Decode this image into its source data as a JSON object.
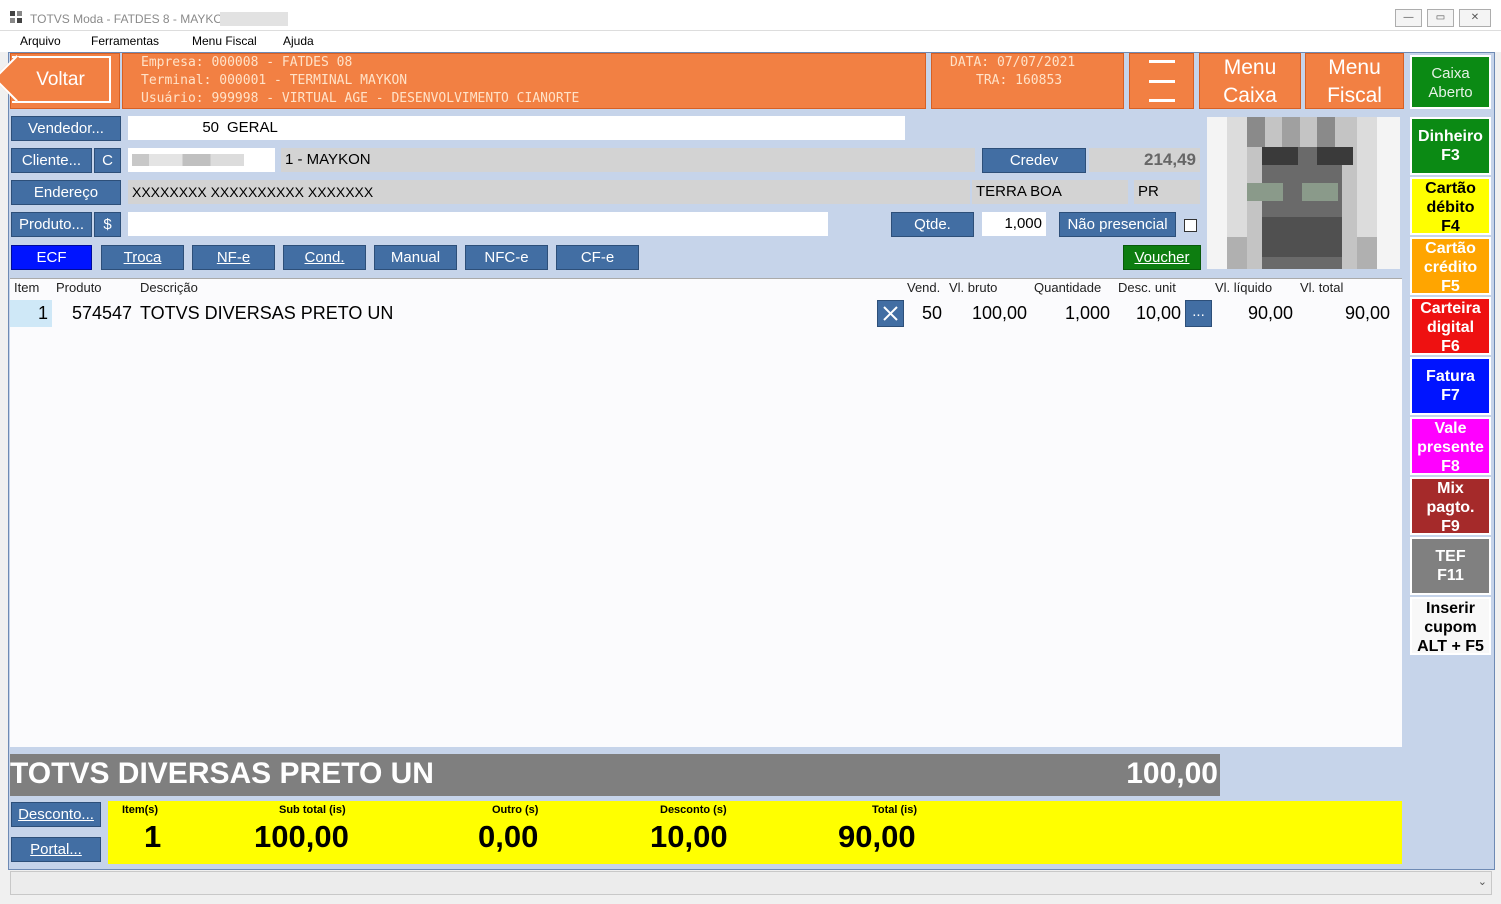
{
  "window": {
    "title": "TOTVS Moda - FATDES 8 - MAYKON",
    "minimize_glyph": "▭",
    "maximize_glyph": "▭",
    "close_glyph": "✕"
  },
  "menu": [
    "Arquivo",
    "Ferramentas",
    "Menu Fiscal",
    "Ajuda"
  ],
  "header": {
    "back_label": "Voltar",
    "empresa": "Empresa: 000008 - FATDES 08",
    "terminal": "Terminal: 000001 - TERMINAL MAYKON",
    "usuario": "Usuário: 999998 - VIRTUAL AGE - DESENVOLVIMENTO CIANORTE",
    "data": "DATA: 07/07/2021",
    "tra": "TRA: 160853",
    "menu_caixa_1": "Menu",
    "menu_caixa_2": "Caixa",
    "menu_fiscal_1": "Menu",
    "menu_fiscal_2": "Fiscal"
  },
  "form": {
    "vendedor_btn": "Vendedor...",
    "vendedor_code": "50",
    "vendedor_name": "GERAL",
    "cliente_btn": "Cliente...",
    "cliente_c": "C",
    "cliente_name": "1 - MAYKON",
    "credev_btn": "Credev",
    "credev_value": "214,49",
    "endereco_btn": "Endereço",
    "endereco_value": "XXXXXXXX XXXXXXXXXX XXXXXXX",
    "cidade": "TERRA BOA",
    "uf": "PR",
    "produto_btn": "Produto...",
    "produto_dollar": "$",
    "qtde_btn": "Qtde.",
    "qtde_value": "1,000",
    "nao_presencial": "Não presencial",
    "voucher_btn": "Voucher"
  },
  "doc_buttons": [
    "ECF",
    "Troca",
    "NF-e",
    "Cond.",
    "Manual",
    "NFC-e",
    "CF-e"
  ],
  "grid": {
    "headers": {
      "item": "Item",
      "produto": "Produto",
      "descricao": "Descrição",
      "vend": "Vend.",
      "vl_bruto": "Vl. bruto",
      "quantidade": "Quantidade",
      "desc_unit": "Desc. unit",
      "vl_liquido": "Vl. líquido",
      "vl_total": "Vl. total"
    },
    "row": {
      "item": "1",
      "produto": "574547",
      "descricao": "TOTVS DIVERSAS PRETO UN",
      "vend": "50",
      "vl_bruto": "100,00",
      "quantidade": "1,000",
      "desc_unit": "10,00",
      "more": "...",
      "vl_liquido": "90,00",
      "vl_total": "90,00"
    }
  },
  "current": {
    "description": "TOTVS DIVERSAS PRETO UN",
    "value": "100,00"
  },
  "bottom_buttons": {
    "desconto": "Desconto...",
    "portal": "Portal..."
  },
  "totals": {
    "itens_label": "Item(s)",
    "itens": "1",
    "subtotal_label": "Sub total (is)",
    "subtotal": "100,00",
    "outro_label": "Outro (s)",
    "outro": "0,00",
    "desconto_label": "Desconto (s)",
    "desconto": "10,00",
    "total_label": "Total (is)",
    "total": "90,00"
  },
  "side": {
    "caixa": "Caixa Aberto",
    "buttons": [
      {
        "label": "Dinheiro",
        "key": "F3",
        "bg": "#0b8a14",
        "color": "#ffffff"
      },
      {
        "label": "Cartão débito",
        "key": "F4",
        "bg": "#ffff00",
        "color": "#000000"
      },
      {
        "label": "Cartão crédito",
        "key": "F5",
        "bg": "#ffa500",
        "color": "#ffffff"
      },
      {
        "label": "Carteira digital",
        "key": "F6",
        "bg": "#ee1111",
        "color": "#ffffff"
      },
      {
        "label": "Fatura",
        "key": "F7",
        "bg": "#0014ff",
        "color": "#ffffff"
      },
      {
        "label": "Vale presente",
        "key": "F8",
        "bg": "#ff00ff",
        "color": "#ffffff"
      },
      {
        "label": "Mix pagto.",
        "key": "F9",
        "bg": "#a52a2a",
        "color": "#ffffff"
      },
      {
        "label": "TEF",
        "key": "F11",
        "bg": "#808080",
        "color": "#ffffff"
      },
      {
        "label": "Inserir cupom",
        "key": "ALT + F5",
        "bg": "#f8f8f8",
        "color": "#000000"
      }
    ]
  }
}
